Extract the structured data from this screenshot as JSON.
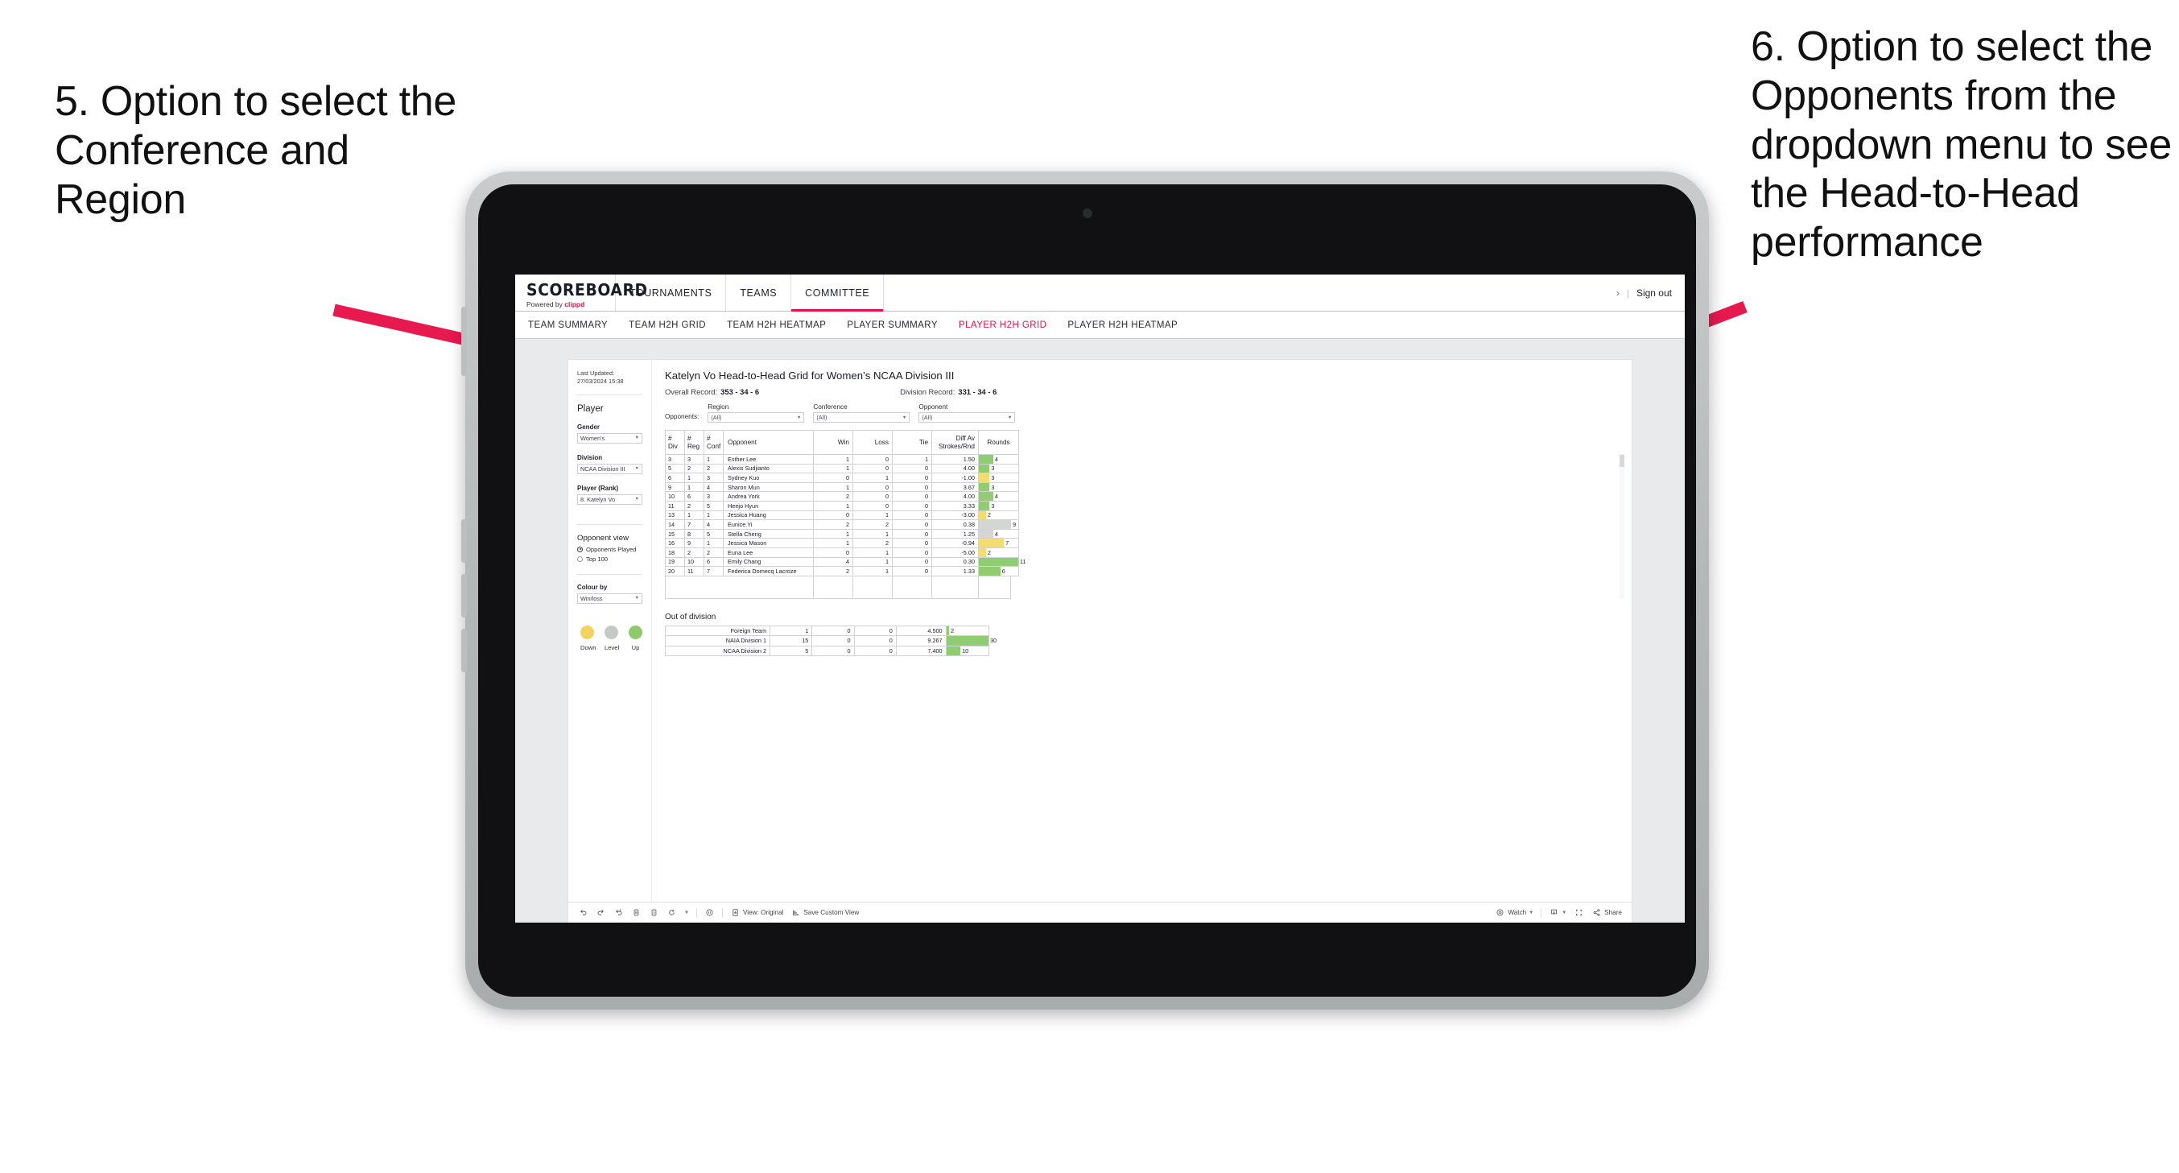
{
  "annotations": {
    "left": "5. Option to select the Conference and Region",
    "right": "6. Option to select the Opponents from the dropdown menu to see the Head-to-Head performance",
    "arrow_color": "#e8194f"
  },
  "topnav": {
    "logo_word": "SCOREBOARD",
    "logo_powered": "Powered by",
    "logo_brand": "clippd",
    "items": [
      {
        "label": "TOURNAMENTS",
        "active": false
      },
      {
        "label": "TEAMS",
        "active": false
      },
      {
        "label": "COMMITTEE",
        "active": true
      }
    ],
    "chevron": "›",
    "separator": "|",
    "signout": "Sign out"
  },
  "subnav": {
    "items": [
      {
        "label": "TEAM SUMMARY",
        "active": false
      },
      {
        "label": "TEAM H2H GRID",
        "active": false
      },
      {
        "label": "TEAM H2H HEATMAP",
        "active": false
      },
      {
        "label": "PLAYER SUMMARY",
        "active": false
      },
      {
        "label": "PLAYER H2H GRID",
        "active": true
      },
      {
        "label": "PLAYER H2H HEATMAP",
        "active": false
      }
    ],
    "active_color": "#e8104b"
  },
  "sidebar": {
    "last_updated": "Last Updated: 27/03/2024 15:38",
    "player_heading": "Player",
    "fields": [
      {
        "label": "Gender",
        "value": "Women’s"
      },
      {
        "label": "Division",
        "value": "NCAA Division III"
      },
      {
        "label": "Player (Rank)",
        "value": "8. Katelyn Vo"
      }
    ],
    "opponent_view_heading": "Opponent view",
    "opponent_view_options": [
      {
        "label": "Opponents Played",
        "selected": true
      },
      {
        "label": "Top 100",
        "selected": false
      }
    ],
    "colour_by_label": "Colour by",
    "colour_by_value": "Win/loss",
    "legend": [
      {
        "label": "Down",
        "color": "#f2d35e"
      },
      {
        "label": "Level",
        "color": "#c6c9c6"
      },
      {
        "label": "Up",
        "color": "#8cca6a"
      }
    ]
  },
  "main": {
    "title": "Katelyn Vo Head-to-Head Grid for Women’s NCAA Division III",
    "overall_record_label": "Overall Record:",
    "overall_record_value": "353 - 34 - 6",
    "division_record_label": "Division Record:",
    "division_record_value": "331 - 34 - 6",
    "filters_label": "Opponents:",
    "filters": [
      {
        "label": "Region",
        "value": "(All)"
      },
      {
        "label": "Conference",
        "value": "(All)"
      },
      {
        "label": "Opponent",
        "value": "(All)"
      }
    ]
  },
  "chart_data": {
    "type": "table",
    "title": "Katelyn Vo Head-to-Head Grid for Women’s NCAA Division III",
    "columns": [
      "# Div",
      "# Reg",
      "# Conf",
      "Opponent",
      "Win",
      "Loss",
      "Tie",
      "Diff Av Strokes/Rnd",
      "Rounds"
    ],
    "column_headers_multiline": [
      {
        "line1": "#",
        "line2": "Div"
      },
      {
        "line1": "#",
        "line2": "Reg"
      },
      {
        "line1": "#",
        "line2": "Conf"
      },
      {
        "line1": "Opponent",
        "line2": ""
      },
      {
        "line1": "Win",
        "line2": ""
      },
      {
        "line1": "Loss",
        "line2": ""
      },
      {
        "line1": "Tie",
        "line2": ""
      },
      {
        "line1": "Diff Av",
        "line2": "Strokes/Rnd"
      },
      {
        "line1": "Rounds",
        "line2": ""
      }
    ],
    "rounds_max": 11,
    "rows": [
      {
        "div": "3",
        "reg": "3",
        "conf": "1",
        "opponent": "Esther Lee",
        "win": "1",
        "loss": "0",
        "tie": "1",
        "diff": "1.50",
        "rounds": 4,
        "tint": "up"
      },
      {
        "div": "5",
        "reg": "2",
        "conf": "2",
        "opponent": "Alexis Sudjianto",
        "win": "1",
        "loss": "0",
        "tie": "0",
        "diff": "4.00",
        "rounds": 3,
        "tint": "up"
      },
      {
        "div": "6",
        "reg": "1",
        "conf": "3",
        "opponent": "Sydney Kuo",
        "win": "0",
        "loss": "1",
        "tie": "0",
        "diff": "-1.00",
        "rounds": 3,
        "tint": "down"
      },
      {
        "div": "9",
        "reg": "1",
        "conf": "4",
        "opponent": "Sharon Mun",
        "win": "1",
        "loss": "0",
        "tie": "0",
        "diff": "3.67",
        "rounds": 3,
        "tint": "up"
      },
      {
        "div": "10",
        "reg": "6",
        "conf": "3",
        "opponent": "Andrea York",
        "win": "2",
        "loss": "0",
        "tie": "0",
        "diff": "4.00",
        "rounds": 4,
        "tint": "up"
      },
      {
        "div": "11",
        "reg": "2",
        "conf": "5",
        "opponent": "Heejo Hyun",
        "win": "1",
        "loss": "0",
        "tie": "0",
        "diff": "3.33",
        "rounds": 3,
        "tint": "up"
      },
      {
        "div": "13",
        "reg": "1",
        "conf": "1",
        "opponent": "Jessica Huang",
        "win": "0",
        "loss": "1",
        "tie": "0",
        "diff": "-3.00",
        "rounds": 2,
        "tint": "down"
      },
      {
        "div": "14",
        "reg": "7",
        "conf": "4",
        "opponent": "Eunice Yi",
        "win": "2",
        "loss": "2",
        "tie": "0",
        "diff": "0.38",
        "rounds": 9,
        "tint": "level",
        "diff_tint": "up"
      },
      {
        "div": "15",
        "reg": "8",
        "conf": "5",
        "opponent": "Stella Cheng",
        "win": "1",
        "loss": "1",
        "tie": "0",
        "diff": "1.25",
        "rounds": 4,
        "tint": "level",
        "diff_tint": "up"
      },
      {
        "div": "16",
        "reg": "9",
        "conf": "1",
        "opponent": "Jessica Mason",
        "win": "1",
        "loss": "2",
        "tie": "0",
        "diff": "-0.94",
        "rounds": 7,
        "tint": "down"
      },
      {
        "div": "18",
        "reg": "2",
        "conf": "2",
        "opponent": "Euna Lee",
        "win": "0",
        "loss": "1",
        "tie": "0",
        "diff": "-5.00",
        "rounds": 2,
        "tint": "down"
      },
      {
        "div": "19",
        "reg": "10",
        "conf": "6",
        "opponent": "Emily Chang",
        "win": "4",
        "loss": "1",
        "tie": "0",
        "diff": "0.30",
        "rounds": 11,
        "tint": "up"
      },
      {
        "div": "20",
        "reg": "11",
        "conf": "7",
        "opponent": "Federica Domecq Lacroze",
        "win": "2",
        "loss": "1",
        "tie": "0",
        "diff": "1.33",
        "rounds": 6,
        "tint": "up"
      }
    ],
    "out_of_division_title": "Out of division",
    "out_of_division_max": 30,
    "out_of_division": [
      {
        "name": "Foreign Team",
        "win": "1",
        "loss": "0",
        "tie": "0",
        "diff": "4.500",
        "rounds": 2,
        "tint": "up"
      },
      {
        "name": "NAIA Division 1",
        "win": "15",
        "loss": "0",
        "tie": "0",
        "diff": "9.267",
        "rounds": 30,
        "tint": "up"
      },
      {
        "name": "NCAA Division 2",
        "win": "5",
        "loss": "0",
        "tie": "0",
        "diff": "7.400",
        "rounds": 10,
        "tint": "up"
      }
    ],
    "tint_colors": {
      "up": "#90cc72",
      "down": "#f2dd6e",
      "level": "#d4d6d3"
    }
  },
  "toolbar": {
    "view_label": "View: Original",
    "save_label": "Save Custom View",
    "watch_label": "Watch",
    "share_label": "Share"
  }
}
